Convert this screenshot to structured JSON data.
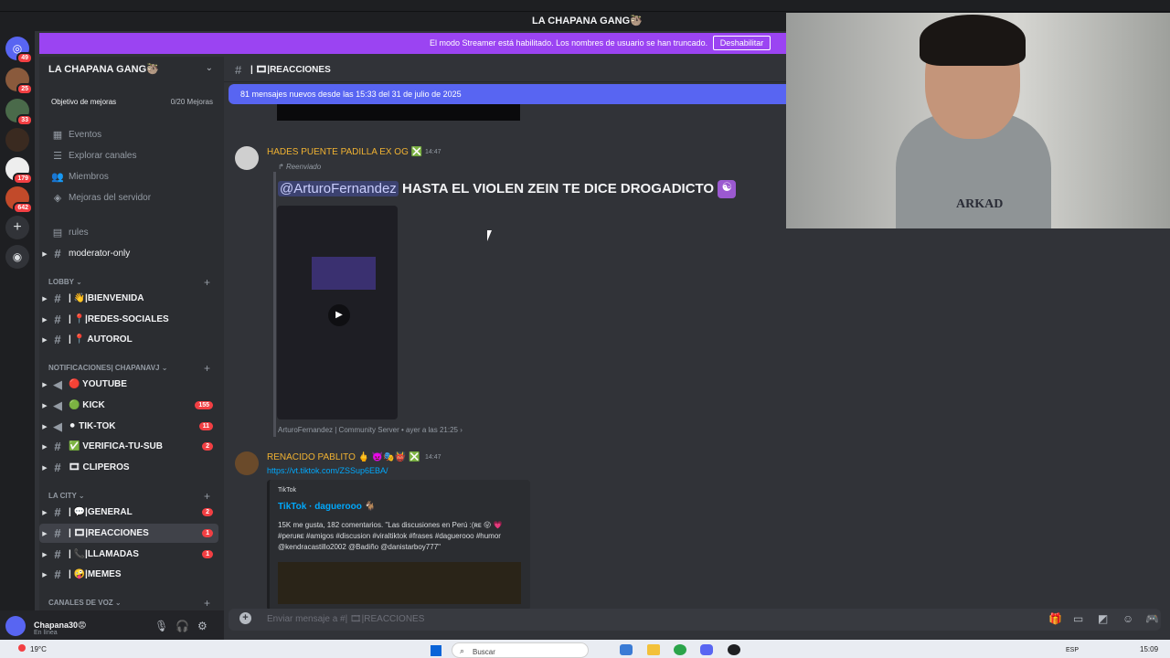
{
  "window": {
    "title": "LA CHAPANA GANG🦥"
  },
  "streamer_banner": {
    "message": "El modo Streamer está habilitado. Los nombres de usuario se han truncado.",
    "button": "Deshabilitar"
  },
  "servers": [
    {
      "badge": "49"
    },
    {
      "badge": "25"
    },
    {
      "badge": "33"
    },
    {
      "badge": ""
    },
    {
      "badge": "179"
    },
    {
      "badge": "642"
    }
  ],
  "sidebar": {
    "guild_name": "LA CHAPANA GANG🦥",
    "boost_goal": "Objetivo de mejoras",
    "boost_count": "0/20 Mejoras",
    "menu": [
      "Eventos",
      "Explorar canales",
      "Miembros",
      "Mejoras del servidor"
    ],
    "top_channels": [
      "rules",
      "moderator-only"
    ],
    "categories": {
      "lobby": "LOBBY",
      "notif": "NOTIFICACIONES| CHAPANAVJ",
      "city": "LA CITY",
      "voice": "CANALES DE VOZ"
    },
    "lobby_channels": [
      {
        "name": "| 👋|BIENVENIDA",
        "count": ""
      },
      {
        "name": "| 📍|REDES-SOCIALES",
        "count": ""
      },
      {
        "name": "| 📍 AUTOROL",
        "count": ""
      }
    ],
    "notif_channels": [
      {
        "name": "🔴 YOUTUBE",
        "count": ""
      },
      {
        "name": "🟢 KICK",
        "count": "155"
      },
      {
        "name": "⚫ TIK-TOK",
        "count": "11"
      },
      {
        "name": "✅ VERIFICA-TU-SUB",
        "count": "2"
      },
      {
        "name": "🎞 CLIPEROS",
        "count": ""
      }
    ],
    "city_channels": [
      {
        "name": "| 💬|GENERAL",
        "count": "2"
      },
      {
        "name": "| 🎞|REACCIONES",
        "count": "1"
      },
      {
        "name": "| 📞|LLAMADAS",
        "count": "1"
      },
      {
        "name": "| 🤪|MEMES",
        "count": ""
      }
    ]
  },
  "user_panel": {
    "name": "Chapana30😡",
    "status": "En línea"
  },
  "channel_header": {
    "name": "| 🎞|REACCIONES"
  },
  "new_messages_bar": "81 mensajes nuevos desde las 15:33 del 31 de julio de 2025",
  "messages": [
    {
      "author": "HADES PUENTE PADILLA EX OG ❎",
      "time": "14:47",
      "forwarded": "Reenviado",
      "mention": "@ArturoFernandez",
      "text": "HASTA EL VIOLEN ZEIN TE DICE DROGADICTO",
      "source": "ArturoFernandez | Community Server",
      "source_time": "ayer a las 21:25"
    },
    {
      "author": "RENACIDO PABLITO 🖕 👿🎭👹 ❎",
      "time": "14:47",
      "link": "https://vt.tiktok.com/ZSSup6EBA/",
      "embed": {
        "provider": "TikTok",
        "title": "TikTok · daguerooo 🐐",
        "description": "15K me gusta, 182 comentarios. \"Las discusiones en Perú :(ʀᴇ 😛 💗 #peruʀᴇ #amigos #discusion #viraltiktok #frases #daguerooo #humor @kendracastillo2002 @Badiño @danistarboy777\""
      }
    }
  ],
  "composer": {
    "placeholder": "Enviar mensaje a #| 🎞|REACCIONES"
  },
  "taskbar": {
    "weather": "19°C",
    "search": "Buscar",
    "lang": "ESP",
    "clock": "15:09"
  },
  "webcam_text": "ARKAD"
}
